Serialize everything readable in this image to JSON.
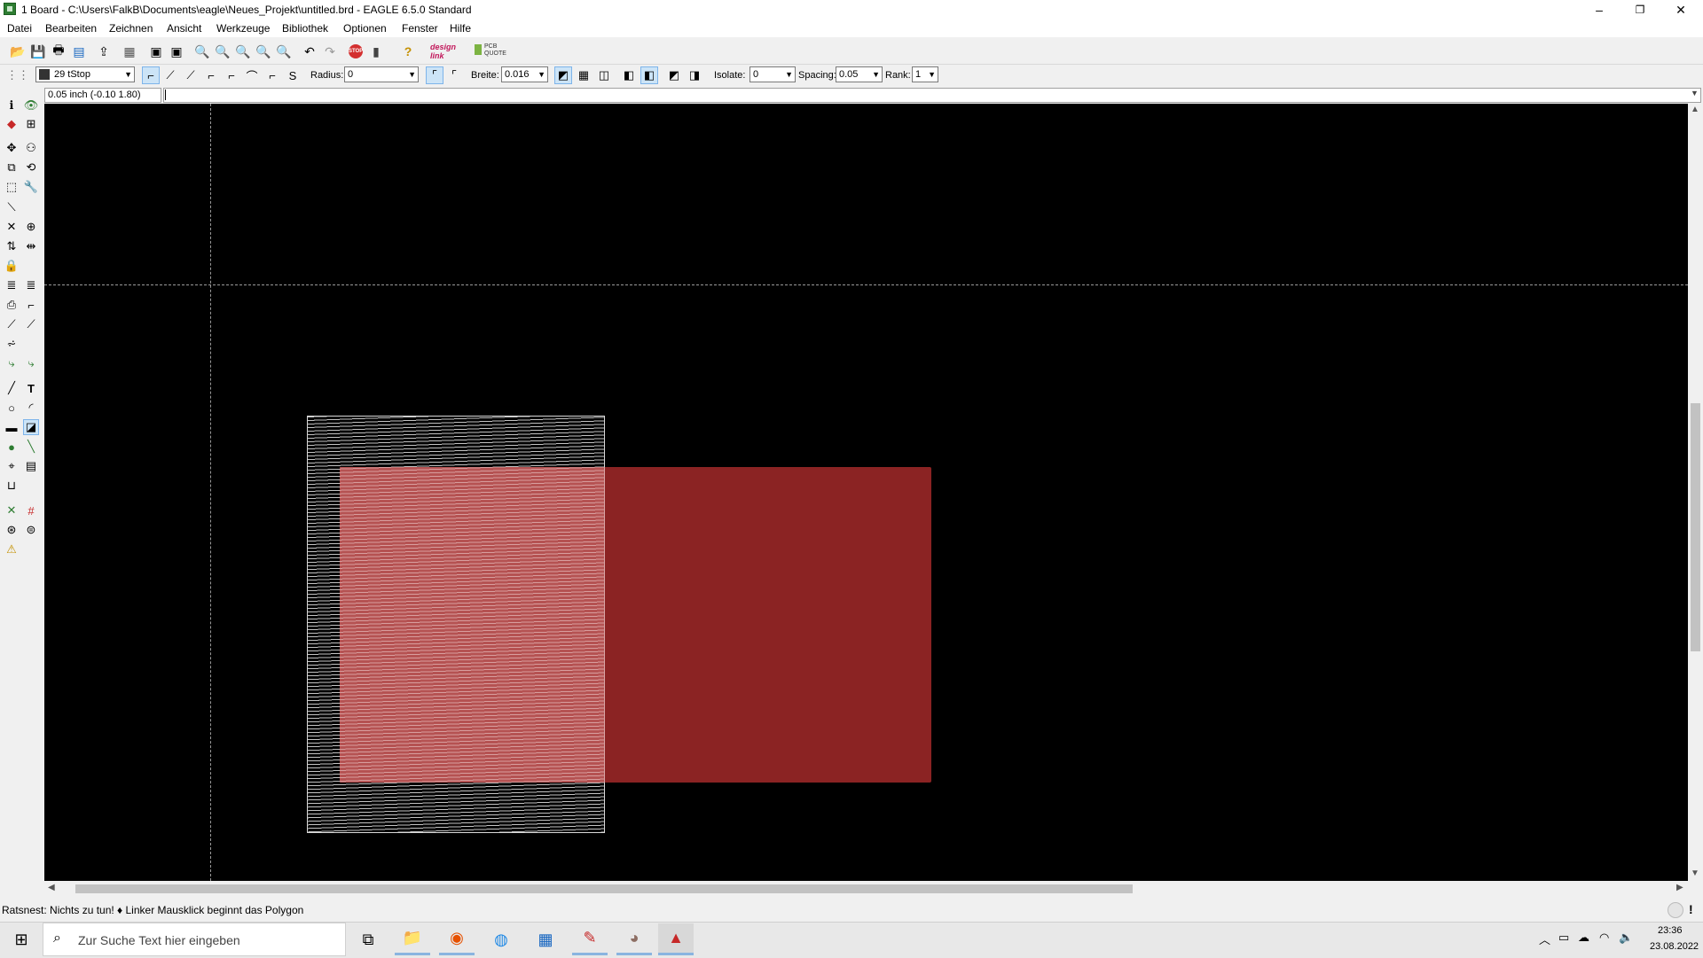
{
  "window": {
    "title": "1 Board - C:\\Users\\FalkB\\Documents\\eagle\\Neues_Projekt\\untitled.brd - EAGLE 6.5.0 Standard",
    "minimize": "–",
    "maximize": "❐",
    "close": "✕"
  },
  "menu": [
    "Datei",
    "Bearbeiten",
    "Zeichnen",
    "Ansicht",
    "Werkzeuge",
    "Bibliothek",
    "Optionen",
    "Fenster",
    "Hilfe"
  ],
  "toolbar": {
    "design_link": "design link",
    "pcb_quote": "PCB QUOTE"
  },
  "params": {
    "layer": "29 tStop",
    "radius_label": "Radius:",
    "radius_value": "0",
    "width_label": "Breite:",
    "width_value": "0.016",
    "isolate_label": "Isolate:",
    "isolate_value": "0",
    "spacing_label": "Spacing:",
    "spacing_value": "0.05",
    "rank_label": "Rank:",
    "rank_value": "1"
  },
  "command": {
    "coordinates": "0.05 inch (-0.10 1.80)",
    "input": ""
  },
  "canvas": {
    "background": "#000000",
    "polygon_color": "#8b2323",
    "hatch_color": "#e6e6e6"
  },
  "status": {
    "text": "Ratsnest: Nichts zu tun!  ♦ Linker Mausklick beginnt das Polygon"
  },
  "taskbar": {
    "search_placeholder": "Zur Suche Text hier eingeben",
    "time": "23:36",
    "date": "23.08.2022"
  }
}
